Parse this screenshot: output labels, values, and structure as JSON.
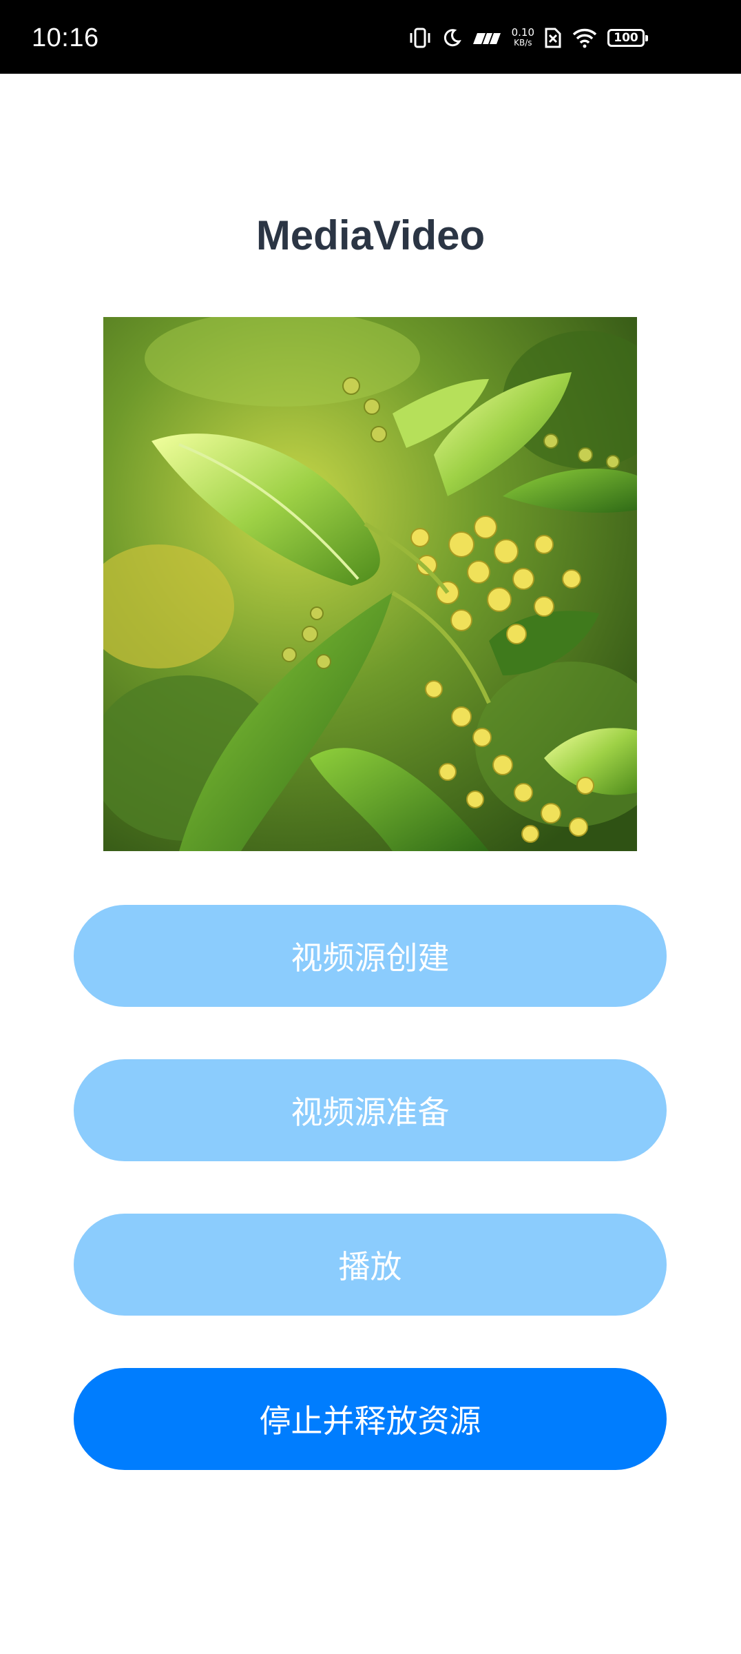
{
  "status_bar": {
    "time": "10:16",
    "network_speed_value": "0.10",
    "network_speed_unit": "KB/s",
    "battery_level": "100",
    "icons": [
      "vibrate-icon",
      "moon-icon",
      "signal-hd-icon",
      "network-speed",
      "no-sim-icon",
      "wifi-icon",
      "battery-icon"
    ]
  },
  "page": {
    "title": "MediaVideo"
  },
  "video": {
    "content": "video-frame-green-leaves-flower-buds"
  },
  "buttons": {
    "create_label": "视频源创建",
    "prepare_label": "视频源准备",
    "play_label": "播放",
    "stop_label": "停止并释放资源"
  },
  "colors": {
    "button_disabled": "#8bccfd",
    "button_active": "#007dfe",
    "title": "#2b3544",
    "status_bar_bg": "#000000"
  }
}
